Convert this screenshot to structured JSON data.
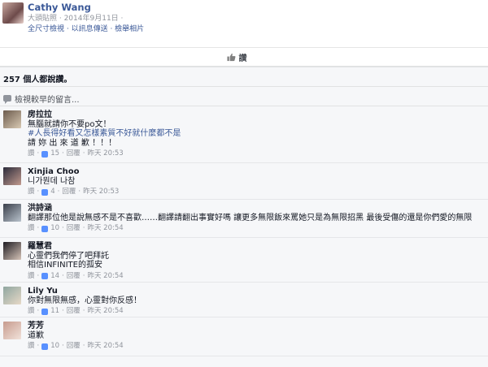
{
  "post": {
    "author": "Cathy Wang",
    "meta": "大頭貼照 · 2014年9月11日 · ",
    "links": "全尺寸檢視 · 以訊息傳送 · 檢舉相片"
  },
  "actions": {
    "like_label": "讚"
  },
  "likes": {
    "text": "257 個人都說讚。"
  },
  "view_previous": {
    "label": "檢視較早的留言..."
  },
  "comments": [
    {
      "author": "房拉拉",
      "lines": [
        "無腦就請你不要po文！",
        "#人長得好看又怎樣素質不好就什麼都不是",
        "請 妳 出 來 道 歉 ！！！"
      ],
      "hashtag_line_index": 1,
      "meta": {
        "like": "讚",
        "count": "15",
        "reply": "回覆",
        "time": "昨天 20:53"
      },
      "avatar_colors": [
        "#6b5a4c",
        "#d8c9b3"
      ]
    },
    {
      "author": "Xinjia Choo",
      "lines": [
        "니가뭔데 나참"
      ],
      "meta": {
        "like": "讚",
        "count": "4",
        "reply": "回覆",
        "time": "昨天 20:53"
      },
      "avatar_colors": [
        "#2a2a3a",
        "#c29a8e"
      ]
    },
    {
      "author": "洪詩涵",
      "lines": [
        "翻譯那位他是說無感不是不喜歡……翻譯請翻出事實好嗎 讓更多無限飯來罵她只是為無限招黑 最後受傷的還是你們愛的無限"
      ],
      "meta": {
        "like": "讚",
        "count": "10",
        "reply": "回覆",
        "time": "昨天 20:54"
      },
      "avatar_colors": [
        "#3a3f4a",
        "#b8c2cc"
      ]
    },
    {
      "author": "羅慧君",
      "lines": [
        "心靈們我們停了吧拜託",
        "相信INFINITE的孤安"
      ],
      "meta": {
        "like": "讚",
        "count": "14",
        "reply": "回覆",
        "time": "昨天 20:54"
      },
      "avatar_colors": [
        "#1e1c22",
        "#d6c4b8"
      ]
    },
    {
      "author": "Lily Yu",
      "lines": [
        "你對無限無感，心靈對你反感！"
      ],
      "meta": {
        "like": "讚",
        "count": "11",
        "reply": "回覆",
        "time": "昨天 20:54"
      },
      "avatar_colors": [
        "#8fa6a0",
        "#e7d9c7"
      ]
    },
    {
      "author": "芳芳",
      "lines": [
        "道歉"
      ],
      "meta": {
        "like": "讚",
        "count": "10",
        "reply": "回覆",
        "time": "昨天 20:54"
      },
      "avatar_colors": [
        "#c79b8e",
        "#f1e2da"
      ]
    }
  ]
}
